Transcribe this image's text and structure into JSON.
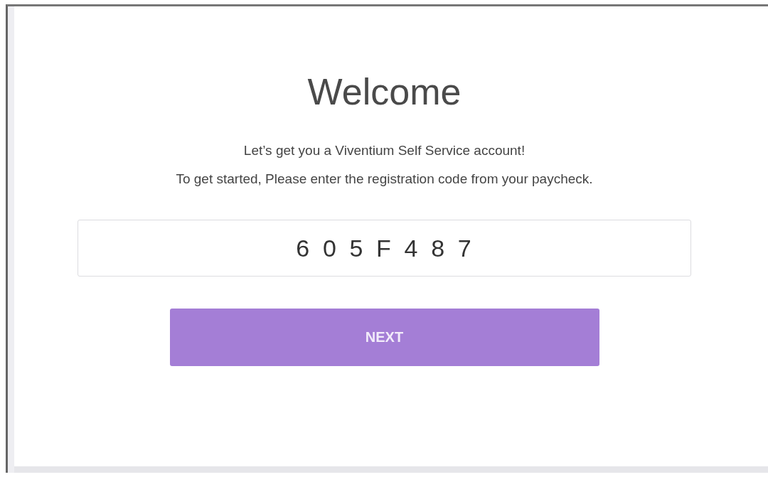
{
  "title": "Welcome",
  "intro": [
    "Let’s get you a Viventium Self Service account!",
    "To get started, Please enter the registration code from your paycheck."
  ],
  "code_field": {
    "value": "605F487"
  },
  "next_button": {
    "label": "NEXT"
  }
}
